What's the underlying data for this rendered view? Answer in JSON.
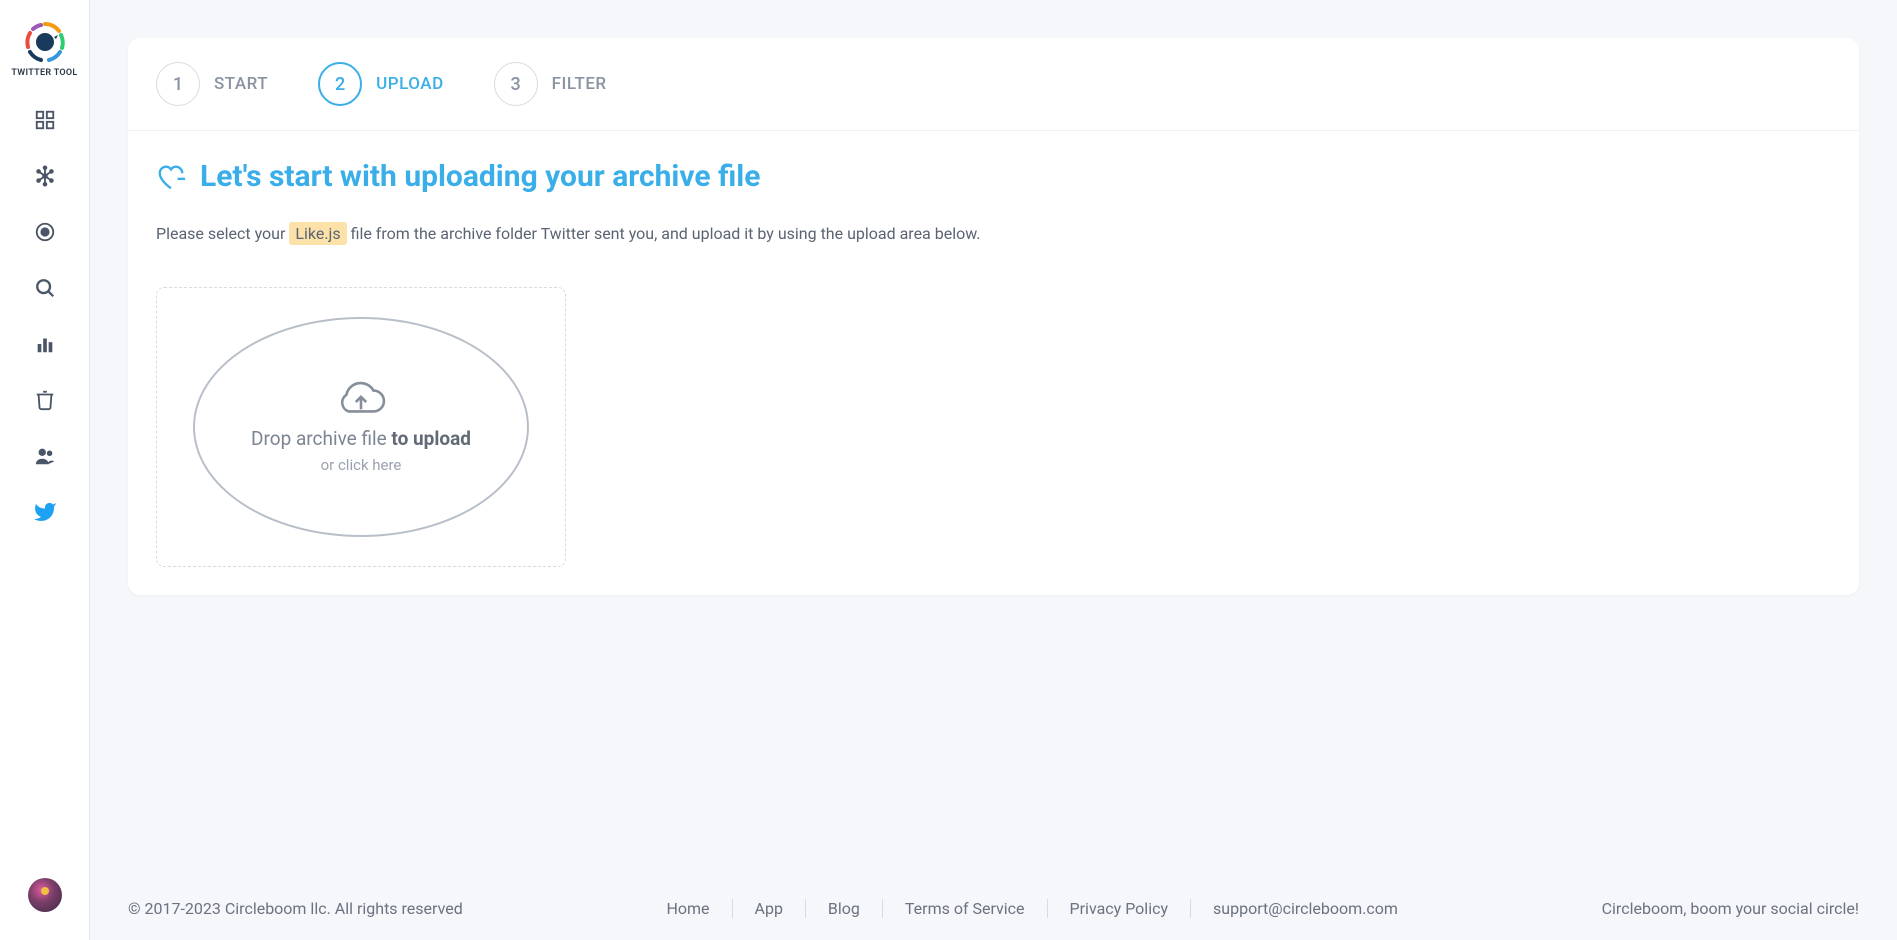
{
  "sidebar": {
    "logo_text": "TWITTER TOOL"
  },
  "steps": [
    {
      "num": "1",
      "label": "START"
    },
    {
      "num": "2",
      "label": "UPLOAD"
    },
    {
      "num": "3",
      "label": "FILTER"
    }
  ],
  "active_step": 2,
  "page": {
    "title": "Let's start with uploading your archive file",
    "instruction_pre": "Please select your ",
    "instruction_highlight": "Like.js",
    "instruction_post": " file from the archive folder Twitter sent you, and upload it by using the upload area below."
  },
  "upload": {
    "line1_plain": "Drop archive file ",
    "line1_bold": "to upload",
    "line2": "or click here"
  },
  "footer": {
    "copyright": "© 2017-2023 Circleboom llc. All rights reserved",
    "links": [
      "Home",
      "App",
      "Blog",
      "Terms of Service",
      "Privacy Policy",
      "support@circleboom.com"
    ],
    "tagline": "Circleboom, boom your social circle!"
  }
}
